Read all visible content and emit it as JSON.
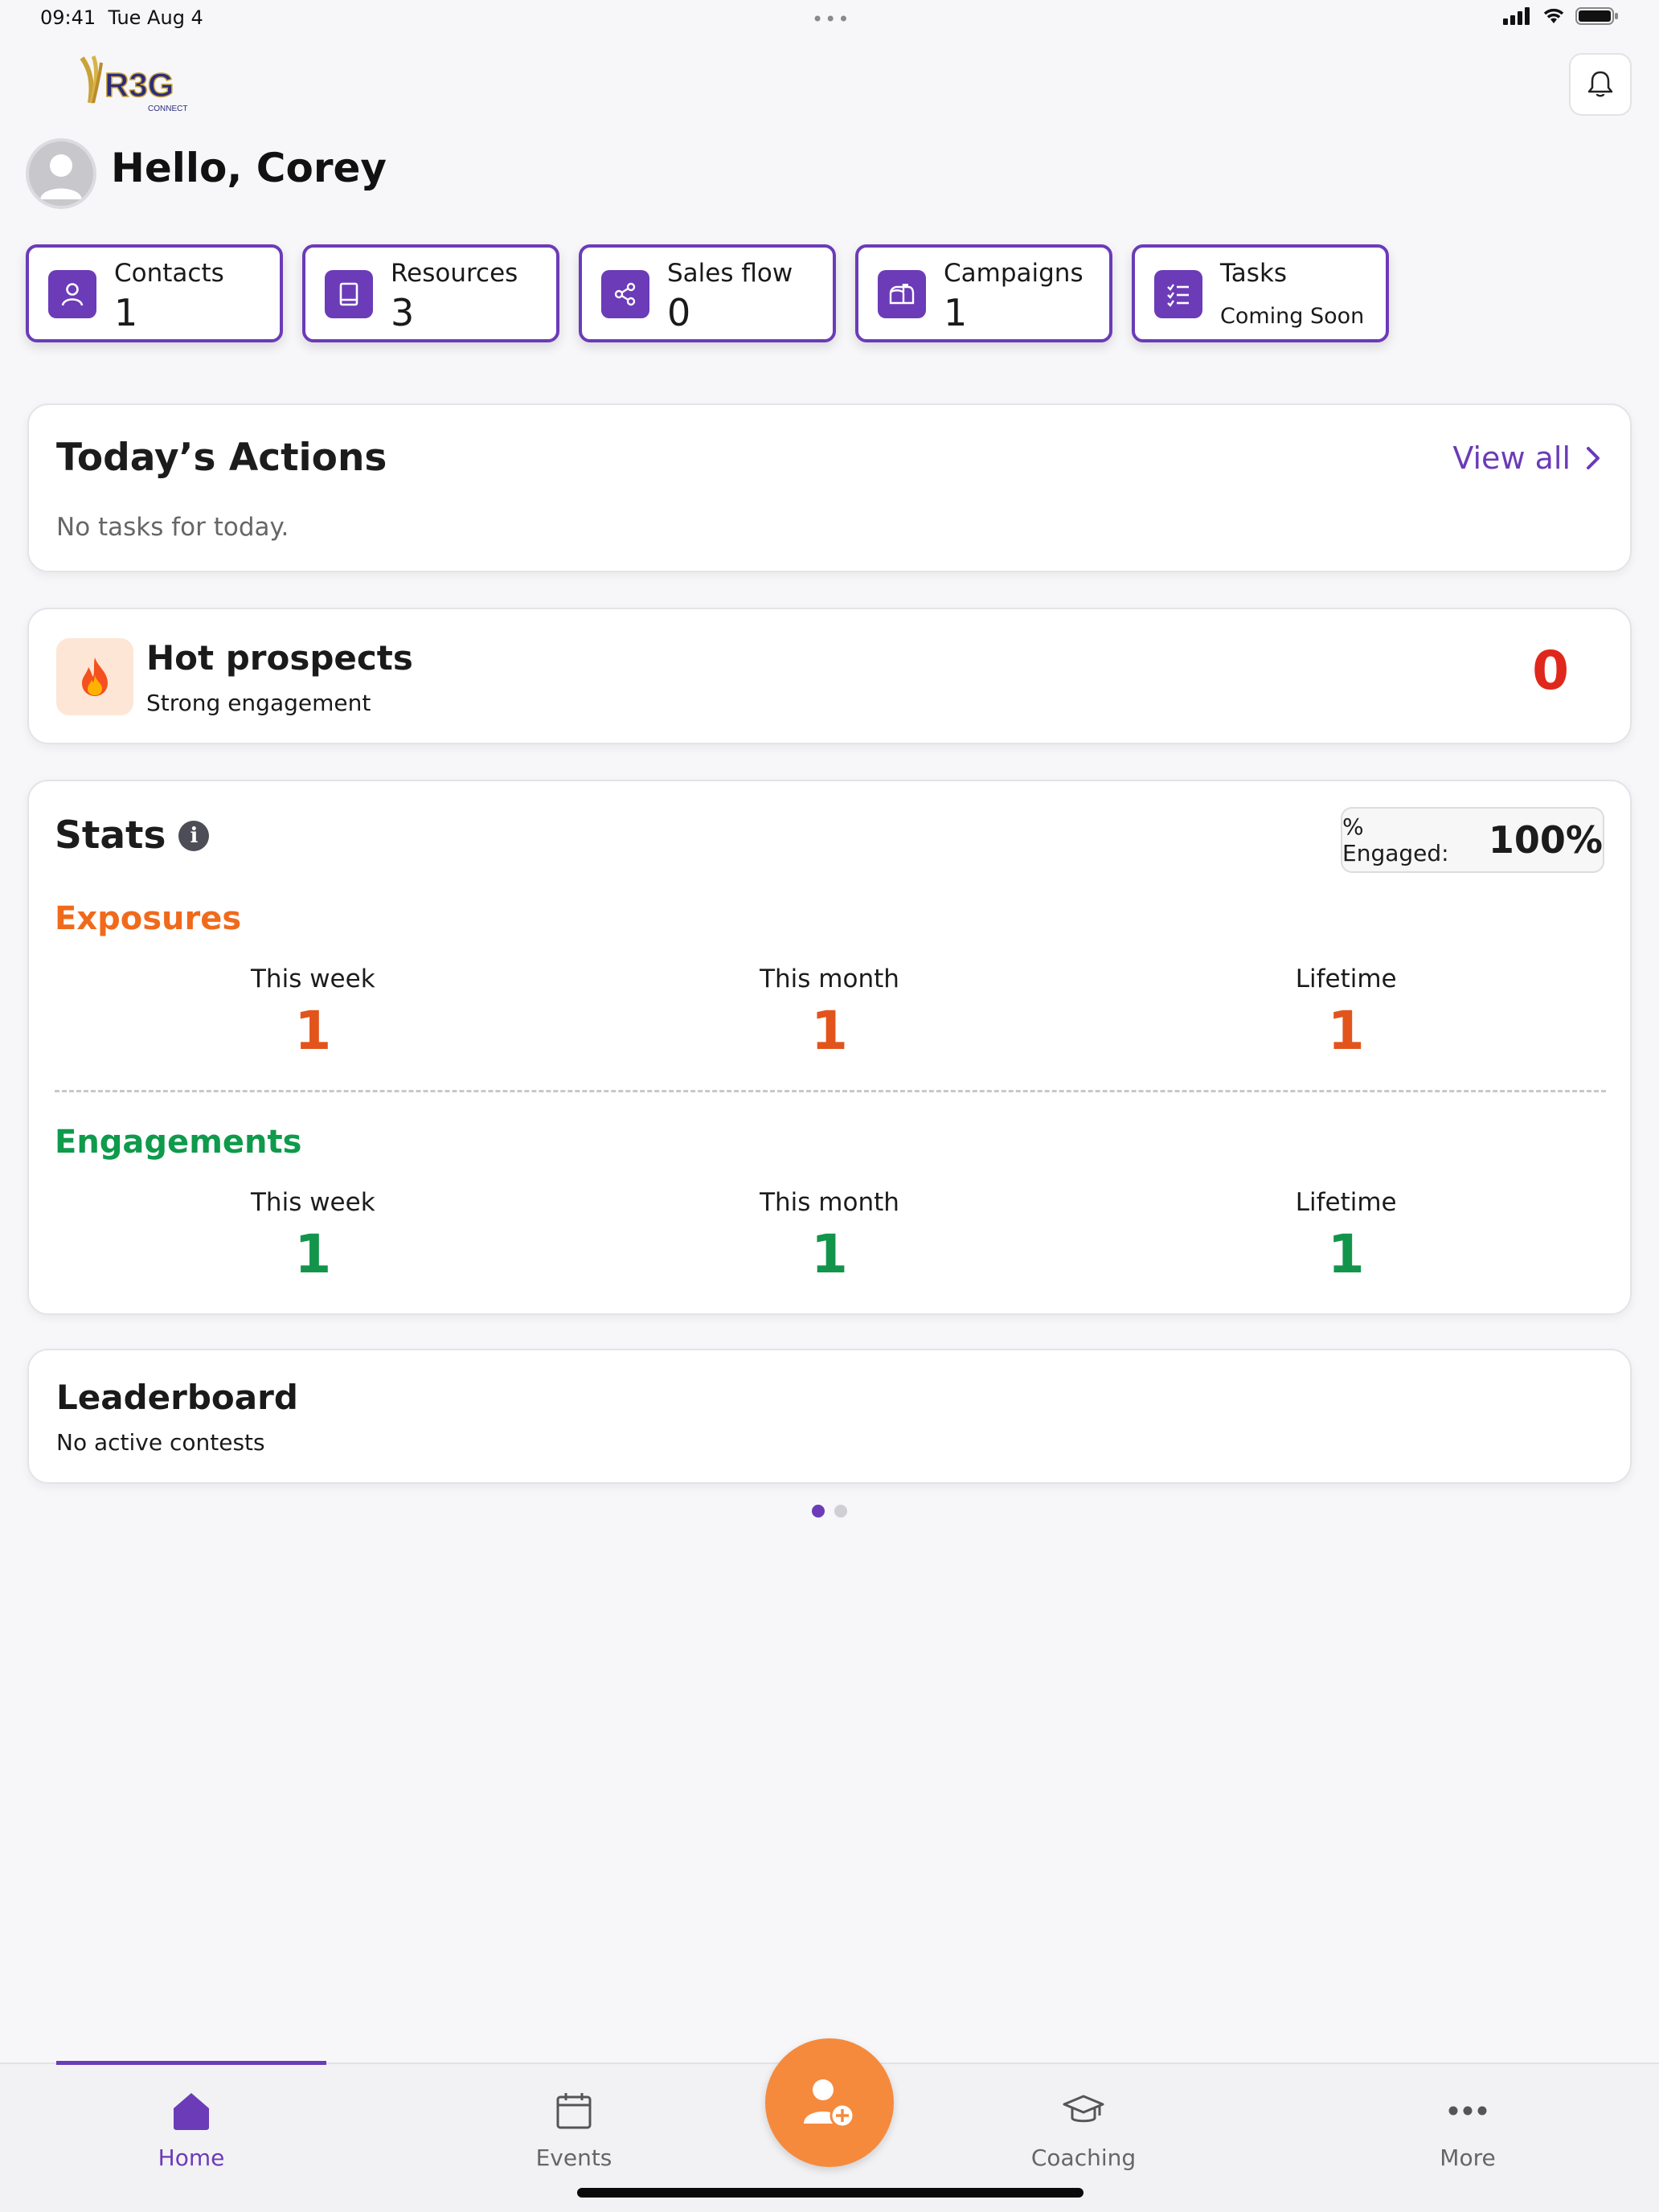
{
  "status_bar": {
    "time": "09:41",
    "date": "Tue Aug 4"
  },
  "header": {
    "logo_text": "R3G",
    "logo_sub": "CONNECT",
    "greeting": "Hello, Corey"
  },
  "quick_cards": [
    {
      "label": "Contacts",
      "value": "1",
      "icon": "person-icon"
    },
    {
      "label": "Resources",
      "value": "3",
      "icon": "book-icon"
    },
    {
      "label": "Sales flow",
      "value": "0",
      "icon": "share-icon"
    },
    {
      "label": "Campaigns",
      "value": "1",
      "icon": "mailbox-icon"
    },
    {
      "label": "Tasks",
      "sub": "Coming Soon",
      "icon": "checklist-icon"
    }
  ],
  "todays_actions": {
    "title": "Today’s Actions",
    "view_all": "View all",
    "empty": "No tasks for today."
  },
  "hot_prospects": {
    "title": "Hot prospects",
    "subtitle": "Strong engagement",
    "count": "0"
  },
  "stats": {
    "title": "Stats",
    "engaged_label": "% Engaged:",
    "engaged_value": "100%",
    "exposures": {
      "title": "Exposures",
      "this_week_label": "This week",
      "this_week": "1",
      "this_month_label": "This month",
      "this_month": "1",
      "lifetime_label": "Lifetime",
      "lifetime": "1"
    },
    "engagements": {
      "title": "Engagements",
      "this_week_label": "This week",
      "this_week": "1",
      "this_month_label": "This month",
      "this_month": "1",
      "lifetime_label": "Lifetime",
      "lifetime": "1"
    }
  },
  "leaderboard": {
    "title": "Leaderboard",
    "subtitle": "No active contests"
  },
  "pager": {
    "pages": 2,
    "active": 1
  },
  "bottom_nav": {
    "home": "Home",
    "events": "Events",
    "coaching": "Coaching",
    "more": "More"
  },
  "colors": {
    "accent": "#6b3bb8",
    "exposures": "#e2541b",
    "engagements": "#12954b",
    "hot_count": "#e0271b",
    "fab": "#f58a3d"
  }
}
